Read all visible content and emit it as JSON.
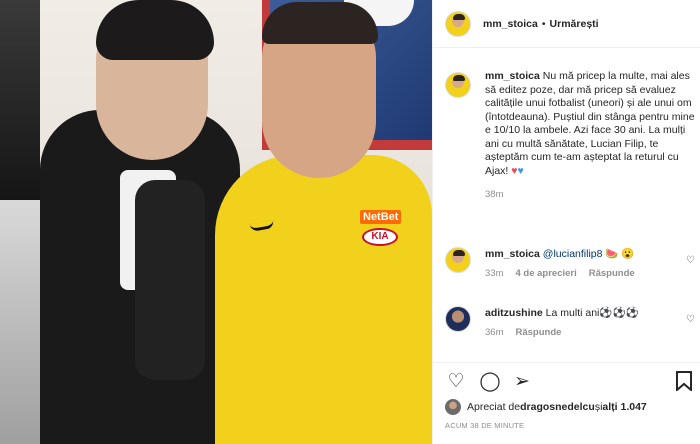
{
  "header": {
    "username": "mm_stoica",
    "separator": "•",
    "follow_label": "Urmărești"
  },
  "caption": {
    "username": "mm_stoica",
    "text": " Nu mă pricep la multe, mai ales să editez poze, dar mă pricep să evaluez calitățile unui fotbalist (uneori) și ale unui om (întotdeauna). Puștiul din stânga pentru mine e 10/10 la ambele. Azi face 30 ani. La mulți ani cu multă sănătate, Lucian Filip, te așteptăm cum te-am așteptat la returul cu Ajax!",
    "emoji_red_heart": "♥",
    "emoji_blue_heart": "♥",
    "time": "38m"
  },
  "comments": [
    {
      "username": "mm_stoica",
      "mention": "@lucianfilip8",
      "emoji": " 🍉 😮",
      "time": "33m",
      "likes": "4 de aprecieri",
      "reply": "Răspunde"
    },
    {
      "username": "aditzushine",
      "text": " La multi ani⚽⚽⚽",
      "time": "36m",
      "reply": "Răspunde"
    }
  ],
  "actions": {
    "like_icon": "heart-outline-icon",
    "comment_icon": "comment-icon",
    "share_icon": "send-icon",
    "save_icon": "bookmark-icon"
  },
  "likes": {
    "prefix": "Apreciat de ",
    "user": "dragosnedelcu",
    "middle": " și ",
    "others": "alți 1.047"
  },
  "timestamp": "ACUM 38 DE MINUTE",
  "photo": {
    "netbet": "NetBet",
    "kia": "KIA"
  }
}
